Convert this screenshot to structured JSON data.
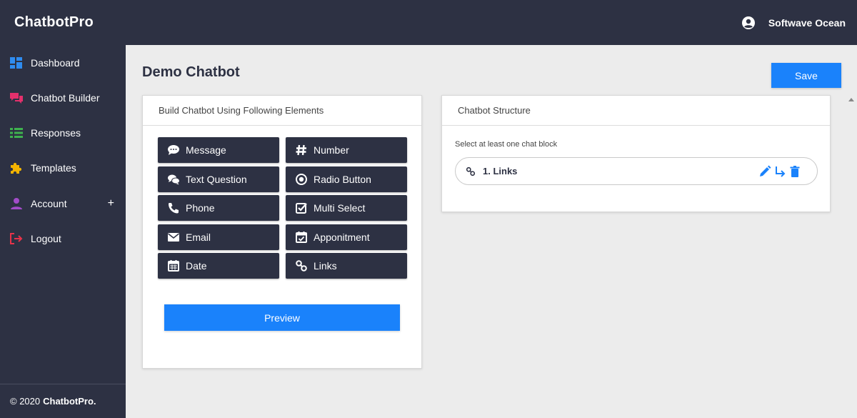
{
  "app": {
    "brand": "ChatbotPro",
    "user_name": "Softwave Ocean"
  },
  "sidebar": {
    "items": [
      {
        "label": "Dashboard",
        "icon": "dashboard-icon",
        "color": "#2f8cf0"
      },
      {
        "label": "Chatbot Builder",
        "icon": "chat-icon",
        "color": "#e4306c"
      },
      {
        "label": "Responses",
        "icon": "list-icon",
        "color": "#3fb24f"
      },
      {
        "label": "Templates",
        "icon": "puzzle-icon",
        "color": "#f4b400"
      },
      {
        "label": "Account",
        "icon": "user-icon",
        "color": "#a24cc9",
        "expand": "+"
      },
      {
        "label": "Logout",
        "icon": "logout-icon",
        "color": "#e8334a"
      }
    ],
    "footer_prefix": "© 2020",
    "footer_brand": "ChatbotPro."
  },
  "page": {
    "title": "Demo Chatbot",
    "save_label": "Save"
  },
  "builder": {
    "heading": "Build Chatbot Using Following Elements",
    "elements": [
      {
        "label": "Message",
        "icon": "message-icon"
      },
      {
        "label": "Number",
        "icon": "hash-icon"
      },
      {
        "label": "Text Question",
        "icon": "comments-icon"
      },
      {
        "label": "Radio Button",
        "icon": "radio-icon"
      },
      {
        "label": "Phone",
        "icon": "phone-icon"
      },
      {
        "label": "Multi Select",
        "icon": "checkbox-icon"
      },
      {
        "label": "Email",
        "icon": "envelope-icon"
      },
      {
        "label": "Apponitment",
        "icon": "calendar-check-icon"
      },
      {
        "label": "Date",
        "icon": "calendar-icon"
      },
      {
        "label": "Links",
        "icon": "link-icon"
      }
    ],
    "preview_label": "Preview"
  },
  "structure": {
    "heading": "Chatbot Structure",
    "hint": "Select at least one chat block",
    "blocks": [
      {
        "label": "1. Links",
        "icon": "link-icon"
      }
    ]
  },
  "colors": {
    "dark": "#2d3143",
    "accent": "#1a82fb",
    "background": "#ececec"
  }
}
